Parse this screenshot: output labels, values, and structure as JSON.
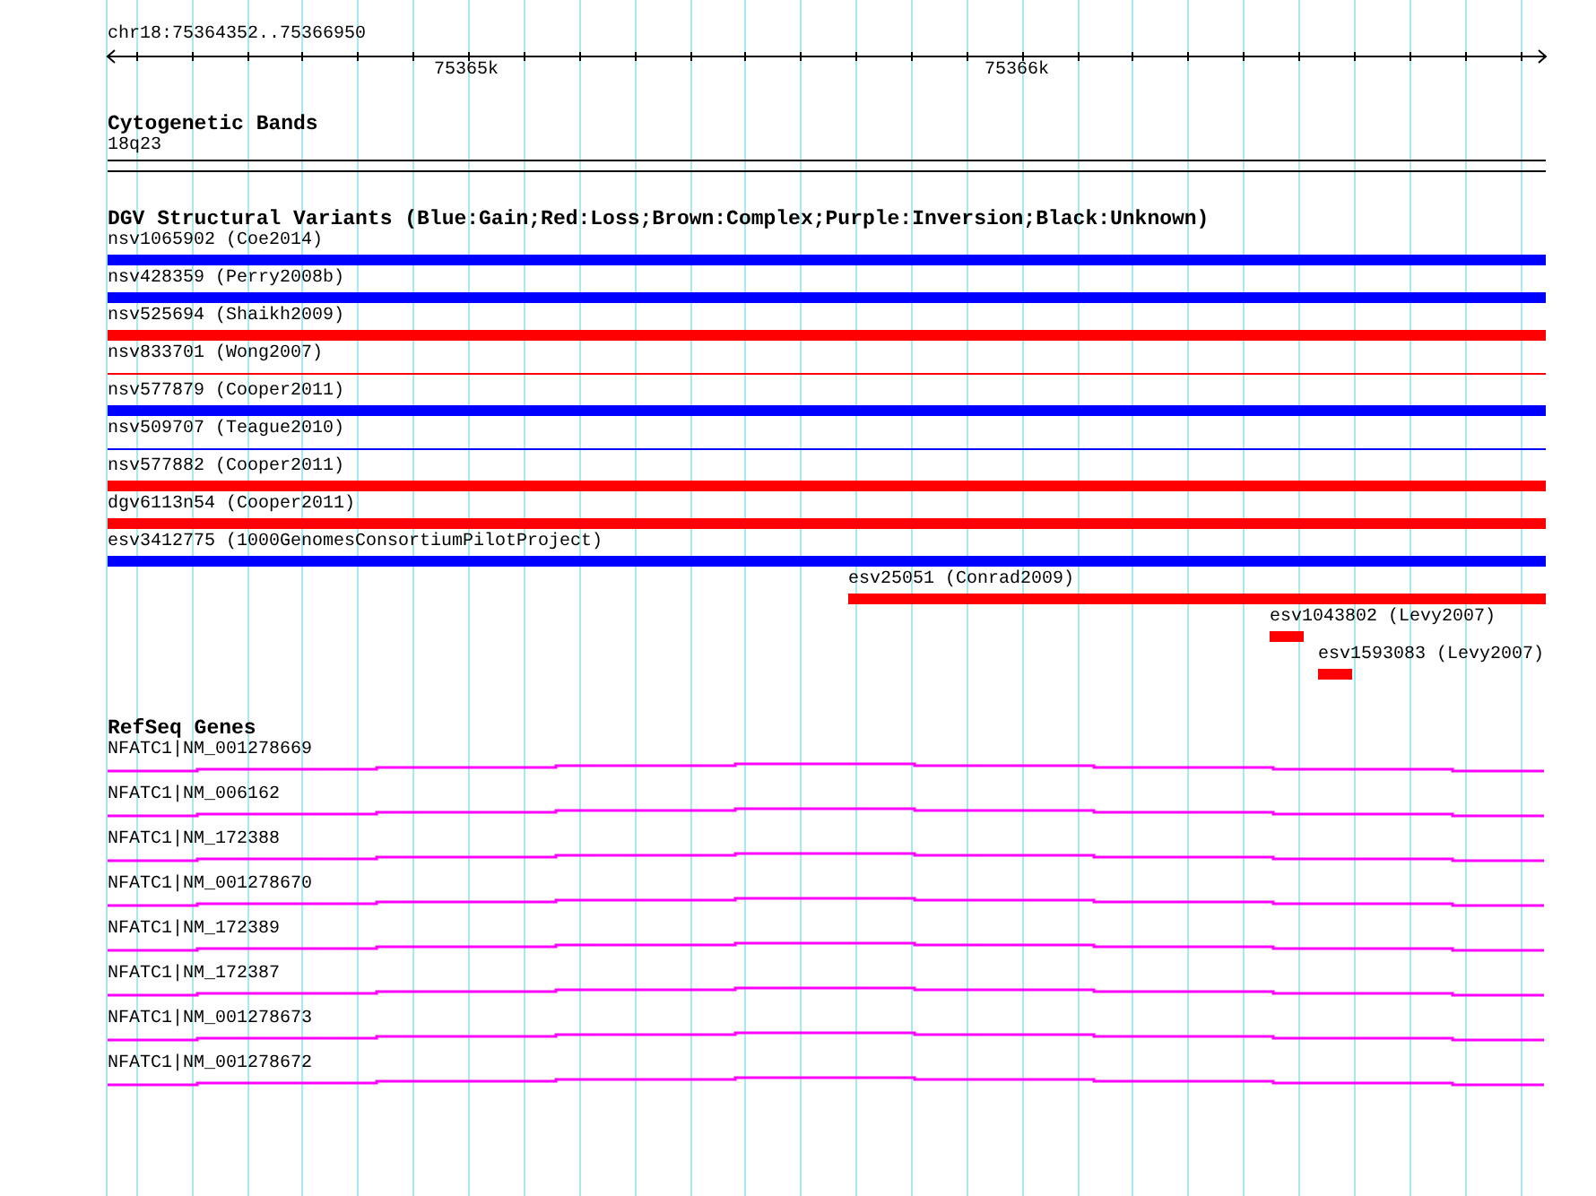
{
  "ruler": {
    "location": "chr18:75364352..75366950",
    "tick_labels": [
      "75365k",
      "75366k"
    ]
  },
  "cytogenetic_bands": {
    "title": "Cytogenetic Bands",
    "band": "18q23"
  },
  "dgv": {
    "title": "DGV Structural Variants (Blue:Gain;Red:Loss;Brown:Complex;Purple:Inversion;Black:Unknown)",
    "variants": [
      {
        "label": "nsv1065902 (Coe2014)",
        "color": "#0000ff",
        "kind": "thick"
      },
      {
        "label": "nsv428359 (Perry2008b)",
        "color": "#0000ff",
        "kind": "thick"
      },
      {
        "label": "nsv525694 (Shaikh2009)",
        "color": "#ff0000",
        "kind": "thick"
      },
      {
        "label": "nsv833701 (Wong2007)",
        "color": "#ff0000",
        "kind": "thin"
      },
      {
        "label": "nsv577879 (Cooper2011)",
        "color": "#0000ff",
        "kind": "thick"
      },
      {
        "label": "nsv509707 (Teague2010)",
        "color": "#0000ff",
        "kind": "thin"
      },
      {
        "label": "nsv577882 (Cooper2011)",
        "color": "#ff0000",
        "kind": "thick"
      },
      {
        "label": "dgv6113n54 (Cooper2011)",
        "color": "#ff0000",
        "kind": "thick"
      },
      {
        "label": "esv3412775 (1000GenomesConsortiumPilotProject)",
        "color": "#0000ff",
        "kind": "thick"
      },
      {
        "label": "esv25051 (Conrad2009)",
        "color": "#ff0000",
        "kind": "thick"
      },
      {
        "label": "esv1043802 (Levy2007)",
        "color": "#ff0000",
        "kind": "thick"
      },
      {
        "label": "esv1593083 (Levy2007)",
        "color": "#ff0000",
        "kind": "thick"
      }
    ]
  },
  "refseq_genes": {
    "title": "RefSeq Genes",
    "genes": [
      {
        "label": "NFATC1|NM_001278669"
      },
      {
        "label": "NFATC1|NM_006162"
      },
      {
        "label": "NFATC1|NM_172388"
      },
      {
        "label": "NFATC1|NM_001278670"
      },
      {
        "label": "NFATC1|NM_172389"
      },
      {
        "label": "NFATC1|NM_172387"
      },
      {
        "label": "NFATC1|NM_001278673"
      },
      {
        "label": "NFATC1|NM_001278672"
      }
    ]
  }
}
